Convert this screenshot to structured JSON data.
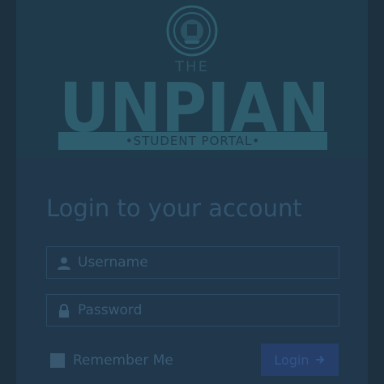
{
  "header": {
    "logo_small": "THE",
    "logo_word": "UNPIAN",
    "logo_subtitle": "•STUDENT PORTAL•"
  },
  "login": {
    "title": "Login to your account",
    "username_placeholder": "Username",
    "password_placeholder": "Password",
    "remember_label": "Remember Me",
    "login_label": "Login",
    "login_icon": "arrow-right-icon"
  },
  "colors": {
    "background": "#223548",
    "logo": "#2e5d6e",
    "button": "#253f6a"
  }
}
